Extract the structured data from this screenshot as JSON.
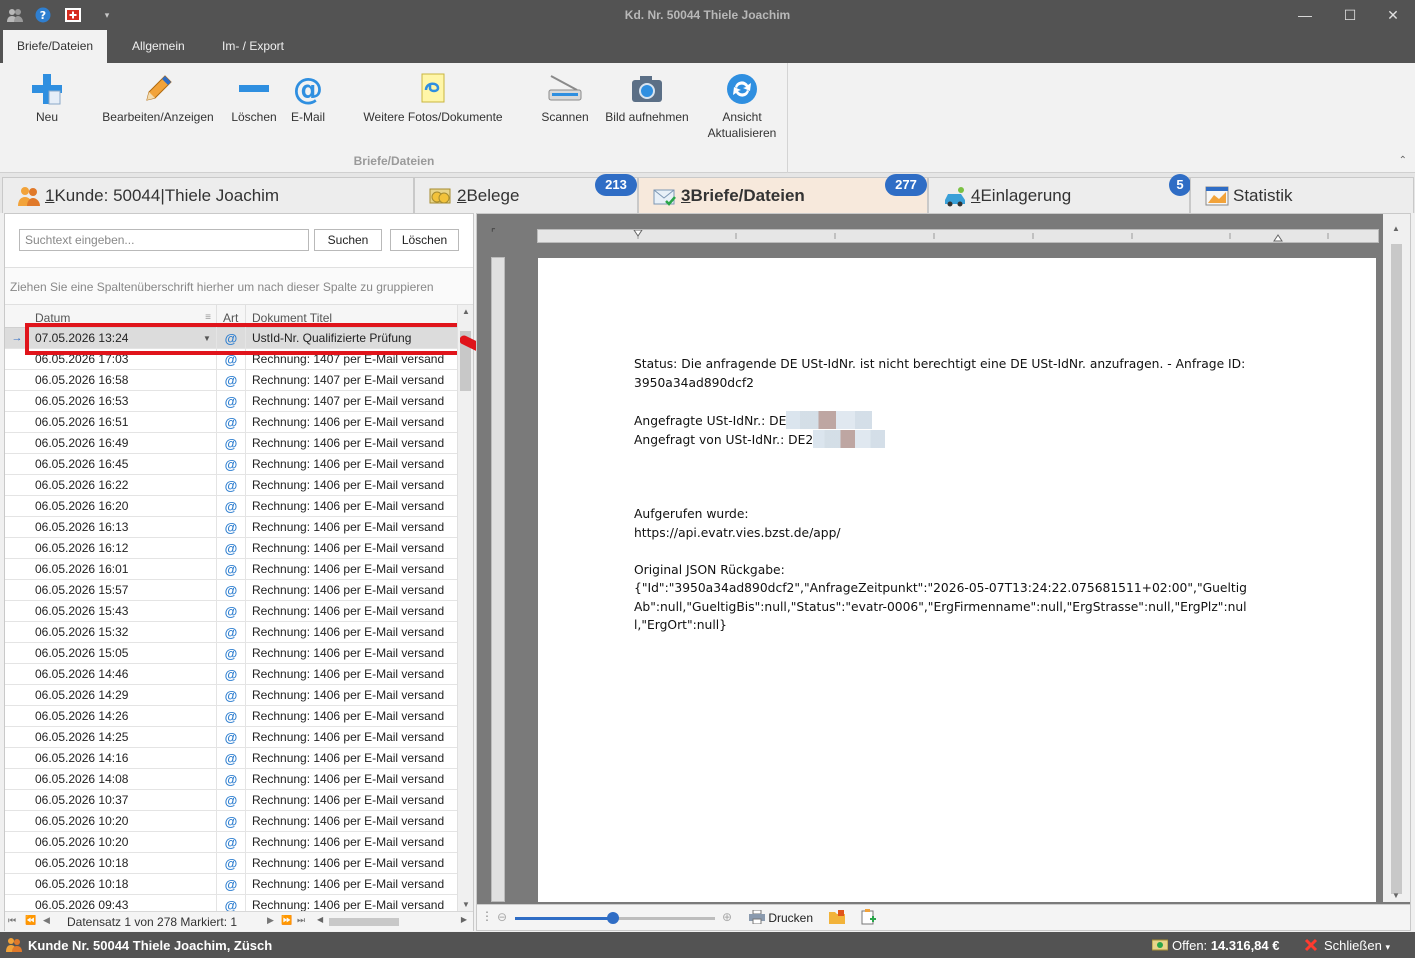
{
  "window": {
    "title": "Kd. Nr. 50044 Thiele Joachim",
    "minimize": "—",
    "maximize": "☐",
    "close": "✕"
  },
  "ribbon": {
    "tabs": [
      {
        "label": "Briefe/Dateien",
        "active": true
      },
      {
        "label": "Allgemein"
      },
      {
        "label": "Im- / Export"
      }
    ],
    "group_label": "Briefe/Dateien",
    "buttons": [
      {
        "label": "Neu",
        "icon": "plus-document-icon"
      },
      {
        "label": "Bearbeiten/Anzeigen",
        "icon": "pencil-icon"
      },
      {
        "label": "Löschen",
        "icon": "minus-icon"
      },
      {
        "label": "E-Mail",
        "icon": "at-sign-icon"
      },
      {
        "label": "Weitere Fotos/Dokumente",
        "icon": "attach-document-icon"
      },
      {
        "label": "Scannen",
        "icon": "scanner-icon"
      },
      {
        "label": "Bild aufnehmen",
        "icon": "camera-icon"
      },
      {
        "label": "Ansicht Aktualisieren",
        "icon": "refresh-icon"
      }
    ]
  },
  "doc_tabs": [
    {
      "number": "1",
      "label": " Kunde: 50044|Thiele Joachim",
      "badge": ""
    },
    {
      "number": "2",
      "label": " Belege",
      "badge": "213"
    },
    {
      "number": "3",
      "label": " Briefe/Dateien",
      "badge": "277",
      "active": true
    },
    {
      "number": "4",
      "label": " Einlagerung",
      "badge": "5"
    },
    {
      "number": "",
      "label": "Statistik",
      "badge": ""
    }
  ],
  "search": {
    "placeholder": "Suchtext eingeben...",
    "search_label": "Suchen",
    "clear_label": "Löschen"
  },
  "grid": {
    "group_hint": "Ziehen Sie eine Spaltenüberschrift hierher um nach dieser Spalte zu gruppieren",
    "columns": {
      "date": "Datum",
      "art": "Art",
      "title": "Dokument Titel"
    },
    "rows": [
      {
        "date": "07.05.2026 13:24",
        "art": "@",
        "title": "UstId-Nr. Qualifizierte Prüfung"
      },
      {
        "date": "06.05.2026 17:03",
        "art": "@",
        "title": "Rechnung: 1407 per E-Mail versand"
      },
      {
        "date": "06.05.2026 16:58",
        "art": "@",
        "title": "Rechnung: 1407 per E-Mail versand"
      },
      {
        "date": "06.05.2026 16:53",
        "art": "@",
        "title": "Rechnung: 1407 per E-Mail versand"
      },
      {
        "date": "06.05.2026 16:51",
        "art": "@",
        "title": "Rechnung: 1406 per E-Mail versand"
      },
      {
        "date": "06.05.2026 16:49",
        "art": "@",
        "title": "Rechnung: 1406 per E-Mail versand"
      },
      {
        "date": "06.05.2026 16:45",
        "art": "@",
        "title": "Rechnung: 1406 per E-Mail versand"
      },
      {
        "date": "06.05.2026 16:22",
        "art": "@",
        "title": "Rechnung: 1406 per E-Mail versand"
      },
      {
        "date": "06.05.2026 16:20",
        "art": "@",
        "title": "Rechnung: 1406 per E-Mail versand"
      },
      {
        "date": "06.05.2026 16:13",
        "art": "@",
        "title": "Rechnung: 1406 per E-Mail versand"
      },
      {
        "date": "06.05.2026 16:12",
        "art": "@",
        "title": "Rechnung: 1406 per E-Mail versand"
      },
      {
        "date": "06.05.2026 16:01",
        "art": "@",
        "title": "Rechnung: 1406 per E-Mail versand"
      },
      {
        "date": "06.05.2026 15:57",
        "art": "@",
        "title": "Rechnung: 1406 per E-Mail versand"
      },
      {
        "date": "06.05.2026 15:43",
        "art": "@",
        "title": "Rechnung: 1406 per E-Mail versand"
      },
      {
        "date": "06.05.2026 15:32",
        "art": "@",
        "title": "Rechnung: 1406 per E-Mail versand"
      },
      {
        "date": "06.05.2026 15:05",
        "art": "@",
        "title": "Rechnung: 1406 per E-Mail versand"
      },
      {
        "date": "06.05.2026 14:46",
        "art": "@",
        "title": "Rechnung: 1406 per E-Mail versand"
      },
      {
        "date": "06.05.2026 14:29",
        "art": "@",
        "title": "Rechnung: 1406 per E-Mail versand"
      },
      {
        "date": "06.05.2026 14:26",
        "art": "@",
        "title": "Rechnung: 1406 per E-Mail versand"
      },
      {
        "date": "06.05.2026 14:25",
        "art": "@",
        "title": "Rechnung: 1406 per E-Mail versand"
      },
      {
        "date": "06.05.2026 14:16",
        "art": "@",
        "title": "Rechnung: 1406 per E-Mail versand"
      },
      {
        "date": "06.05.2026 14:08",
        "art": "@",
        "title": "Rechnung: 1406 per E-Mail versand"
      },
      {
        "date": "06.05.2026 10:37",
        "art": "@",
        "title": "Rechnung: 1406 per E-Mail versand"
      },
      {
        "date": "06.05.2026 10:20",
        "art": "@",
        "title": "Rechnung: 1406 per E-Mail versand"
      },
      {
        "date": "06.05.2026 10:20",
        "art": "@",
        "title": "Rechnung: 1406 per E-Mail versand"
      },
      {
        "date": "06.05.2026 10:18",
        "art": "@",
        "title": "Rechnung: 1406 per E-Mail versand"
      },
      {
        "date": "06.05.2026 10:18",
        "art": "@",
        "title": "Rechnung: 1406 per E-Mail versand"
      },
      {
        "date": "06.05.2026 09:43",
        "art": "@",
        "title": "Rechnung: 1406 per E-Mail versand"
      }
    ],
    "record_info": "Datensatz 1 von 278 Markiert: 1"
  },
  "preview": {
    "lines": [
      "Status: Die anfragende DE USt-IdNr. ist nicht berechtigt eine DE USt-IdNr. anzufragen. - Anfrage ID: 3950a34ad890dcf2",
      "",
      "Angefragte USt-IdNr.: DE",
      "Angefragt von USt-IdNr.: DE2",
      "",
      "",
      "Aufgerufen wurde:",
      "https://api.evatr.vies.bzst.de/app/",
      "",
      "Original JSON Rückgabe:",
      "{\"Id\":\"3950a34ad890dcf2\",\"AnfrageZeitpunkt\":\"2026-05-07T13:24:22.075681511+02:00\",\"GueltigAb\":null,\"GueltigBis\":null,\"Status\":\"evatr-0006\",\"ErgFirmenname\":null,\"ErgStrasse\":null,\"ErgPlz\":null,\"ErgOrt\":null}"
    ],
    "zoom_fraction": 0.49,
    "print_label": "Drucken"
  },
  "statusbar": {
    "customer": "Kunde Nr. 50044 Thiele Joachim, Züsch",
    "offen_label": "Offen:",
    "offen_value": "14.316,84 €",
    "close_label": "Schließen"
  },
  "colors": {
    "chrome": "#535353",
    "accent": "#2f6dc5",
    "highlight_red": "#e0141b",
    "active_tab": "#f7e9dc"
  }
}
